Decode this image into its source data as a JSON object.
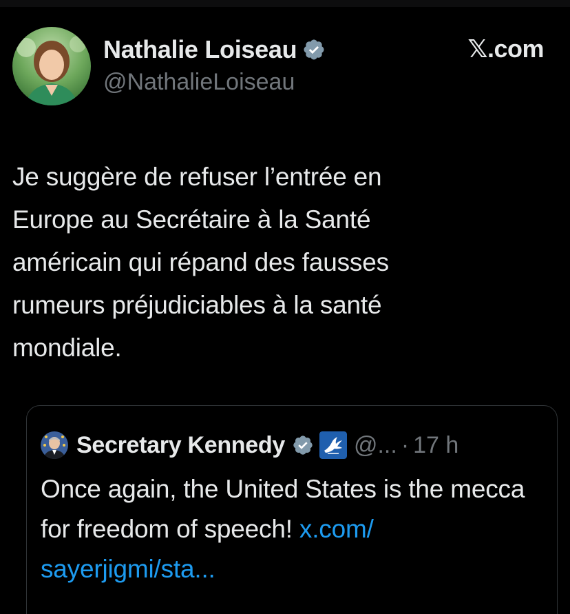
{
  "tweet": {
    "author": {
      "name": "Nathalie Loiseau",
      "handle": "@NathalieLoiseau",
      "verified_icon": "verified-badge-icon"
    },
    "brand": "𝕏.com",
    "text": "Je suggère de refuser l’entrée en\nEurope au Secrétaire à la Santé\naméricain qui répand des fausses\nrumeurs préjudiciables à la santé\nmondiale."
  },
  "quoted": {
    "author": {
      "name": "Secretary Kennedy",
      "handle": "@...",
      "affiliation_icon": "hhs-eagle-icon"
    },
    "separator": "·",
    "time": "17 h",
    "text": "Once again, the United States is the mecca for freedom of speech! ",
    "link": "x.com/\nsayerjigmi/sta..."
  },
  "colors": {
    "background": "#000000",
    "text": "#e7e9ea",
    "secondary": "#71767b",
    "link": "#1d9bf0",
    "verified_gray": "#829aab",
    "hhs_blue": "#1f5fae"
  }
}
